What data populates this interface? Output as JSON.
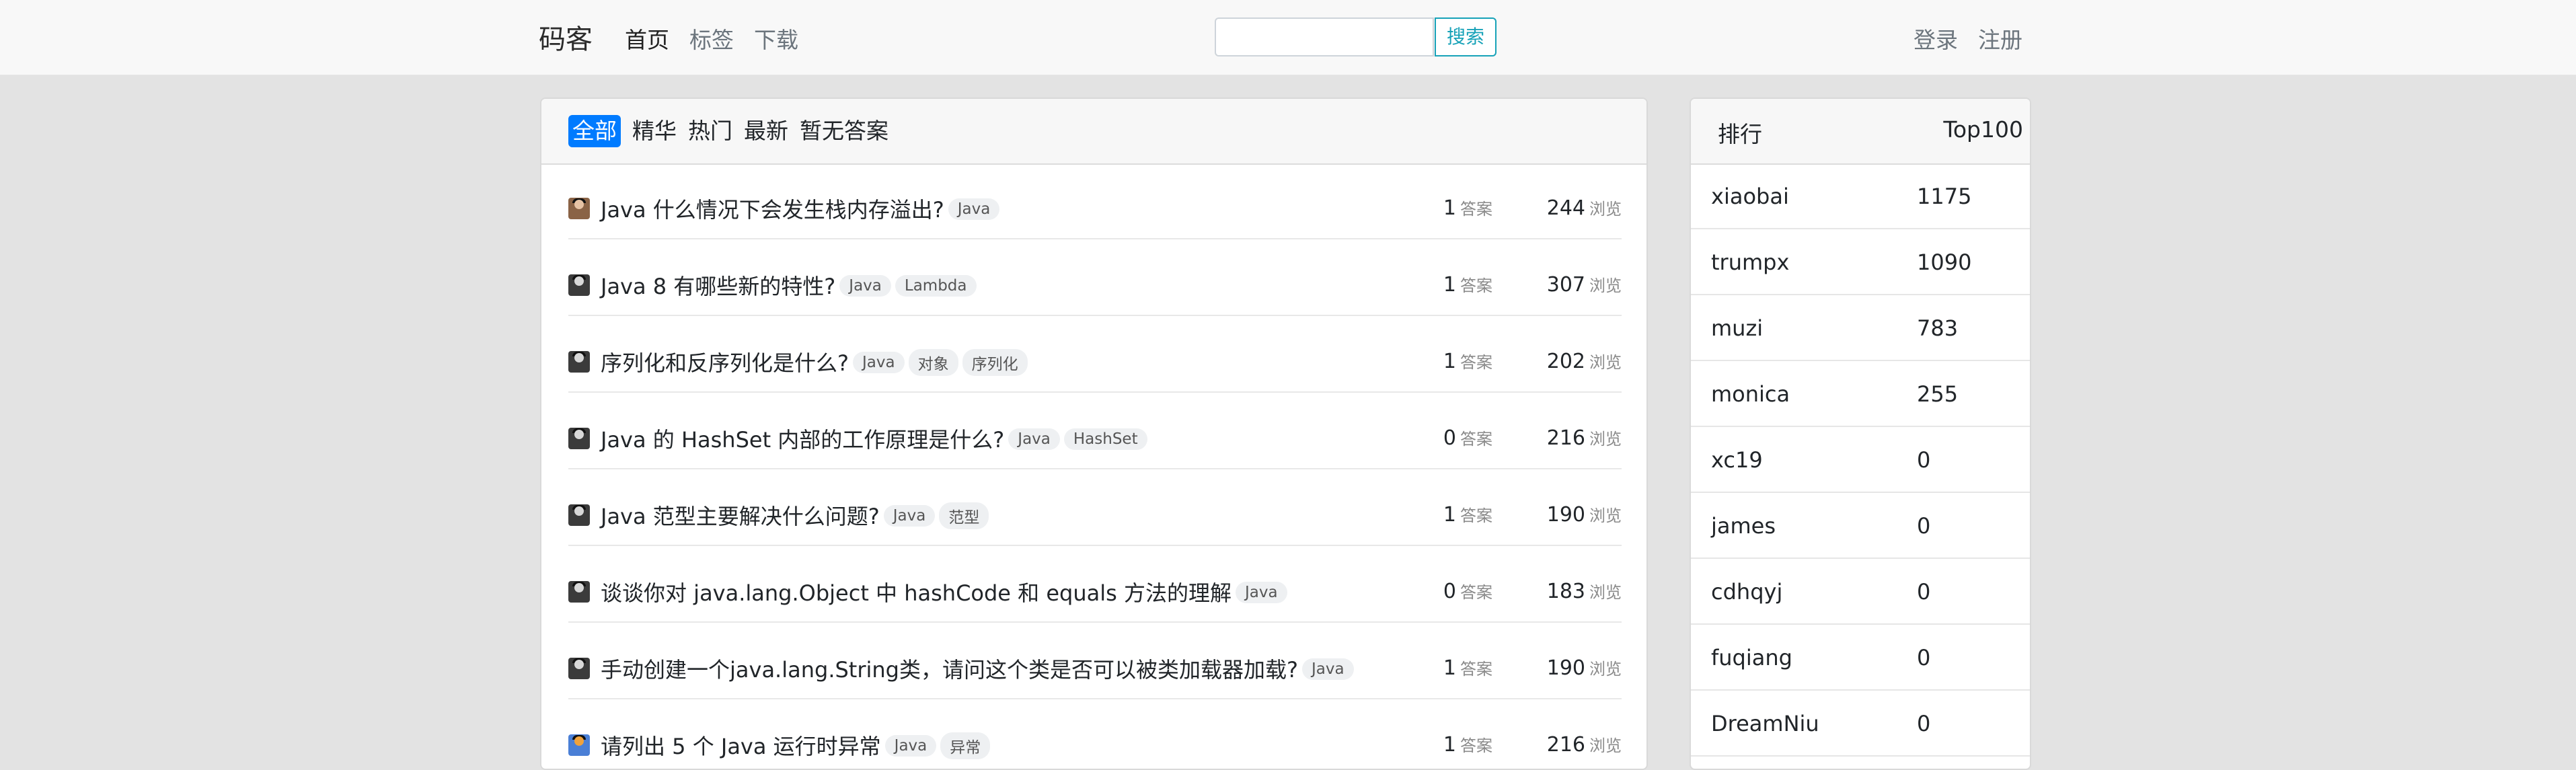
{
  "nav": {
    "brand": "码客",
    "links": [
      "首页",
      "标签",
      "下载"
    ],
    "search_placeholder": "",
    "search_button": "搜索",
    "login": "登录",
    "register": "注册"
  },
  "filters": [
    "全部",
    "精华",
    "热门",
    "最新",
    "暂无答案"
  ],
  "questions": [
    {
      "title": "Java 什么情况下会发生栈内存溢出?",
      "tags": [
        "Java"
      ],
      "answers": "1",
      "answers_label": "答案",
      "views": "244",
      "views_label": "浏览",
      "avatar": "brown-avatar"
    },
    {
      "title": "Java 8 有哪些新的特性?",
      "tags": [
        "Java",
        "Lambda"
      ],
      "answers": "1",
      "answers_label": "答案",
      "views": "307",
      "views_label": "浏览",
      "avatar": "user-avatar"
    },
    {
      "title": "序列化和反序列化是什么?",
      "tags": [
        "Java",
        "对象",
        "序列化"
      ],
      "answers": "1",
      "answers_label": "答案",
      "views": "202",
      "views_label": "浏览",
      "avatar": "user-avatar"
    },
    {
      "title": "Java 的 HashSet 内部的工作原理是什么?",
      "tags": [
        "Java",
        "HashSet"
      ],
      "answers": "0",
      "answers_label": "答案",
      "views": "216",
      "views_label": "浏览",
      "avatar": "user-avatar"
    },
    {
      "title": "Java 范型主要解决什么问题?",
      "tags": [
        "Java",
        "范型"
      ],
      "answers": "1",
      "answers_label": "答案",
      "views": "190",
      "views_label": "浏览",
      "avatar": "user-avatar"
    },
    {
      "title": "谈谈你对 java.lang.Object 中 hashCode 和 equals 方法的理解",
      "tags": [
        "Java"
      ],
      "answers": "0",
      "answers_label": "答案",
      "views": "183",
      "views_label": "浏览",
      "avatar": "user-avatar"
    },
    {
      "title": "手动创建一个java.lang.String类，请问这个类是否可以被类加载器加载?",
      "tags": [
        "Java"
      ],
      "answers": "1",
      "answers_label": "答案",
      "views": "190",
      "views_label": "浏览",
      "avatar": "user-avatar"
    },
    {
      "title": "请列出 5 个 Java 运行时异常",
      "tags": [
        "Java",
        "异常"
      ],
      "answers": "1",
      "answers_label": "答案",
      "views": "216",
      "views_label": "浏览",
      "avatar": "colorful-avatar"
    }
  ],
  "ranking": {
    "title": "排行",
    "link": "Top100",
    "rows": [
      {
        "name": "xiaobai",
        "score": "1175"
      },
      {
        "name": "trumpx",
        "score": "1090"
      },
      {
        "name": "muzi",
        "score": "783"
      },
      {
        "name": "monica",
        "score": "255"
      },
      {
        "name": "xc19",
        "score": "0"
      },
      {
        "name": "james",
        "score": "0"
      },
      {
        "name": "cdhqyj",
        "score": "0"
      },
      {
        "name": "fuqiang",
        "score": "0"
      },
      {
        "name": "DreamNiu",
        "score": "0"
      }
    ]
  },
  "colors": {
    "accent": "#007bff",
    "search": "#17a2b8",
    "background": "#e3e3e3"
  }
}
